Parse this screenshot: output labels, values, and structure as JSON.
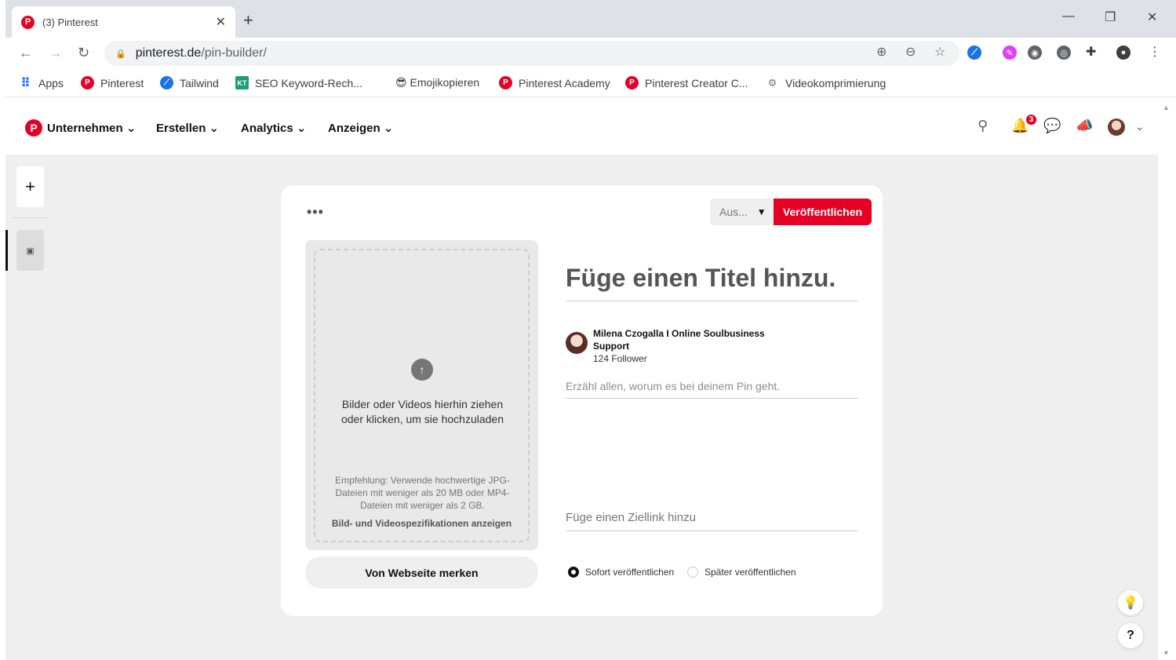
{
  "browser": {
    "tab_title": "(3) Pinterest",
    "favicon_letter": "P",
    "url_host": "pinterest.de",
    "url_path": "/pin-builder/"
  },
  "bookmarks": [
    {
      "label": "Apps"
    },
    {
      "label": "Pinterest"
    },
    {
      "label": "Tailwind"
    },
    {
      "label": "SEO Keyword-Rech..."
    },
    {
      "label": "😎 Emojikopieren"
    },
    {
      "label": "Pinterest Academy"
    },
    {
      "label": "Pinterest Creator C..."
    },
    {
      "label": "Videokomprimierung"
    }
  ],
  "header": {
    "nav": [
      {
        "label": "Unternehmen"
      },
      {
        "label": "Erstellen"
      },
      {
        "label": "Analytics"
      },
      {
        "label": "Anzeigen"
      }
    ],
    "notification_count": "3"
  },
  "builder": {
    "more_label": "•••",
    "board_placeholder": "Aus...",
    "publish_label": "Veröffentlichen",
    "upload_text": "Bilder oder Videos hierhin ziehen oder klicken, um sie hochzuladen",
    "upload_recommendation": "Empfehlung: Verwende hochwertige JPG-Dateien mit weniger als 20 MB oder MP4-Dateien mit weniger als 2 GB.",
    "upload_specs_link": "Bild- und Videospezifikationen anzeigen",
    "save_from_site": "Von Webseite merken",
    "title_placeholder": "Füge einen Titel hinzu.",
    "author_name": "Milena Czogalla I Online Soulbusiness Support",
    "author_followers": "124 Follower",
    "description_placeholder": "Erzähl allen, worum es bei deinem Pin geht.",
    "link_placeholder": "Füge einen Ziellink hinzu",
    "publish_now": "Sofort veröffentlichen",
    "publish_later": "Später veröffentlichen"
  },
  "colors": {
    "brand": "#e60023",
    "background": "#efefef"
  }
}
